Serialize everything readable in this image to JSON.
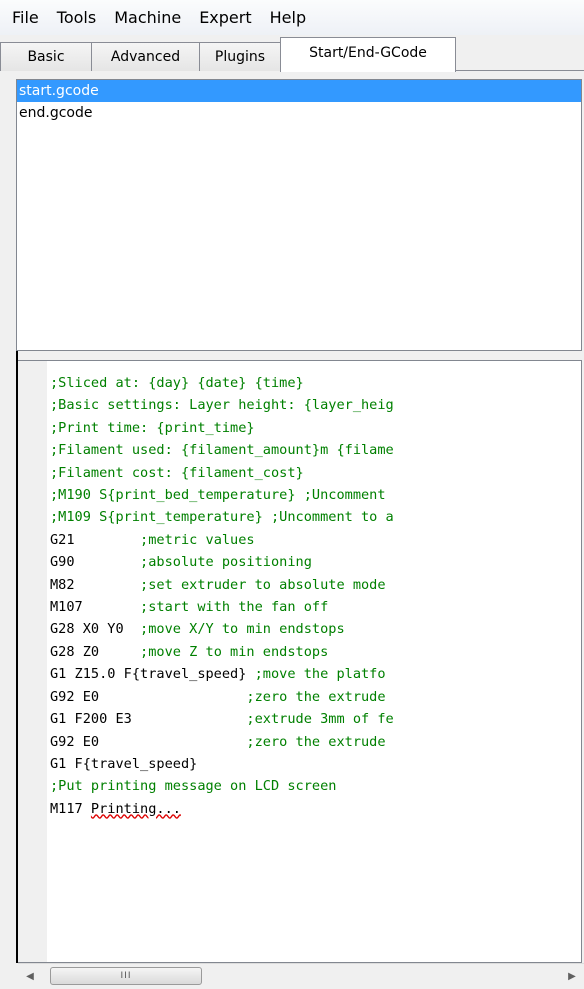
{
  "menubar": {
    "items": [
      "File",
      "Tools",
      "Machine",
      "Expert",
      "Help"
    ]
  },
  "tabs": [
    {
      "label": "Basic",
      "active": false
    },
    {
      "label": "Advanced",
      "active": false
    },
    {
      "label": "Plugins",
      "active": false
    },
    {
      "label": "Start/End-GCode",
      "active": true
    }
  ],
  "file_list": {
    "items": [
      "start.gcode",
      "end.gcode"
    ],
    "selected": "start.gcode"
  },
  "editor": {
    "lines": [
      [
        ";Sliced at: {day} {date} {time}",
        ""
      ],
      [
        ";Basic settings: Layer height: {layer_heig",
        ""
      ],
      [
        ";Print time: {print_time}",
        ""
      ],
      [
        ";Filament used: {filament_amount}m {filame",
        ""
      ],
      [
        ";Filament cost: {filament_cost}",
        ""
      ],
      [
        ";M190 S{print_bed_temperature} ;Uncomment ",
        ""
      ],
      [
        ";M109 S{print_temperature} ;Uncomment to a",
        ""
      ],
      [
        "G21        ",
        ";metric values"
      ],
      [
        "G90        ",
        ";absolute positioning"
      ],
      [
        "M82        ",
        ";set extruder to absolute mode"
      ],
      [
        "M107       ",
        ";start with the fan off"
      ],
      [
        "G28 X0 Y0  ",
        ";move X/Y to min endstops"
      ],
      [
        "G28 Z0     ",
        ";move Z to min endstops"
      ],
      [
        "G1 Z15.0 F{travel_speed} ",
        ";move the platfo"
      ],
      [
        "G92 E0                  ",
        ";zero the extrude"
      ],
      [
        "G1 F200 E3              ",
        ";extrude 3mm of fe"
      ],
      [
        "G92 E0                  ",
        ";zero the extrude"
      ],
      [
        "G1 F{travel_speed}",
        ""
      ],
      [
        ";Put printing message on LCD screen",
        ""
      ],
      [
        "M117 ",
        "",
        "Printing..."
      ]
    ]
  },
  "scrollbar": {
    "left_arrow": "◀",
    "right_arrow": "▶",
    "thumb_grip": "III"
  }
}
